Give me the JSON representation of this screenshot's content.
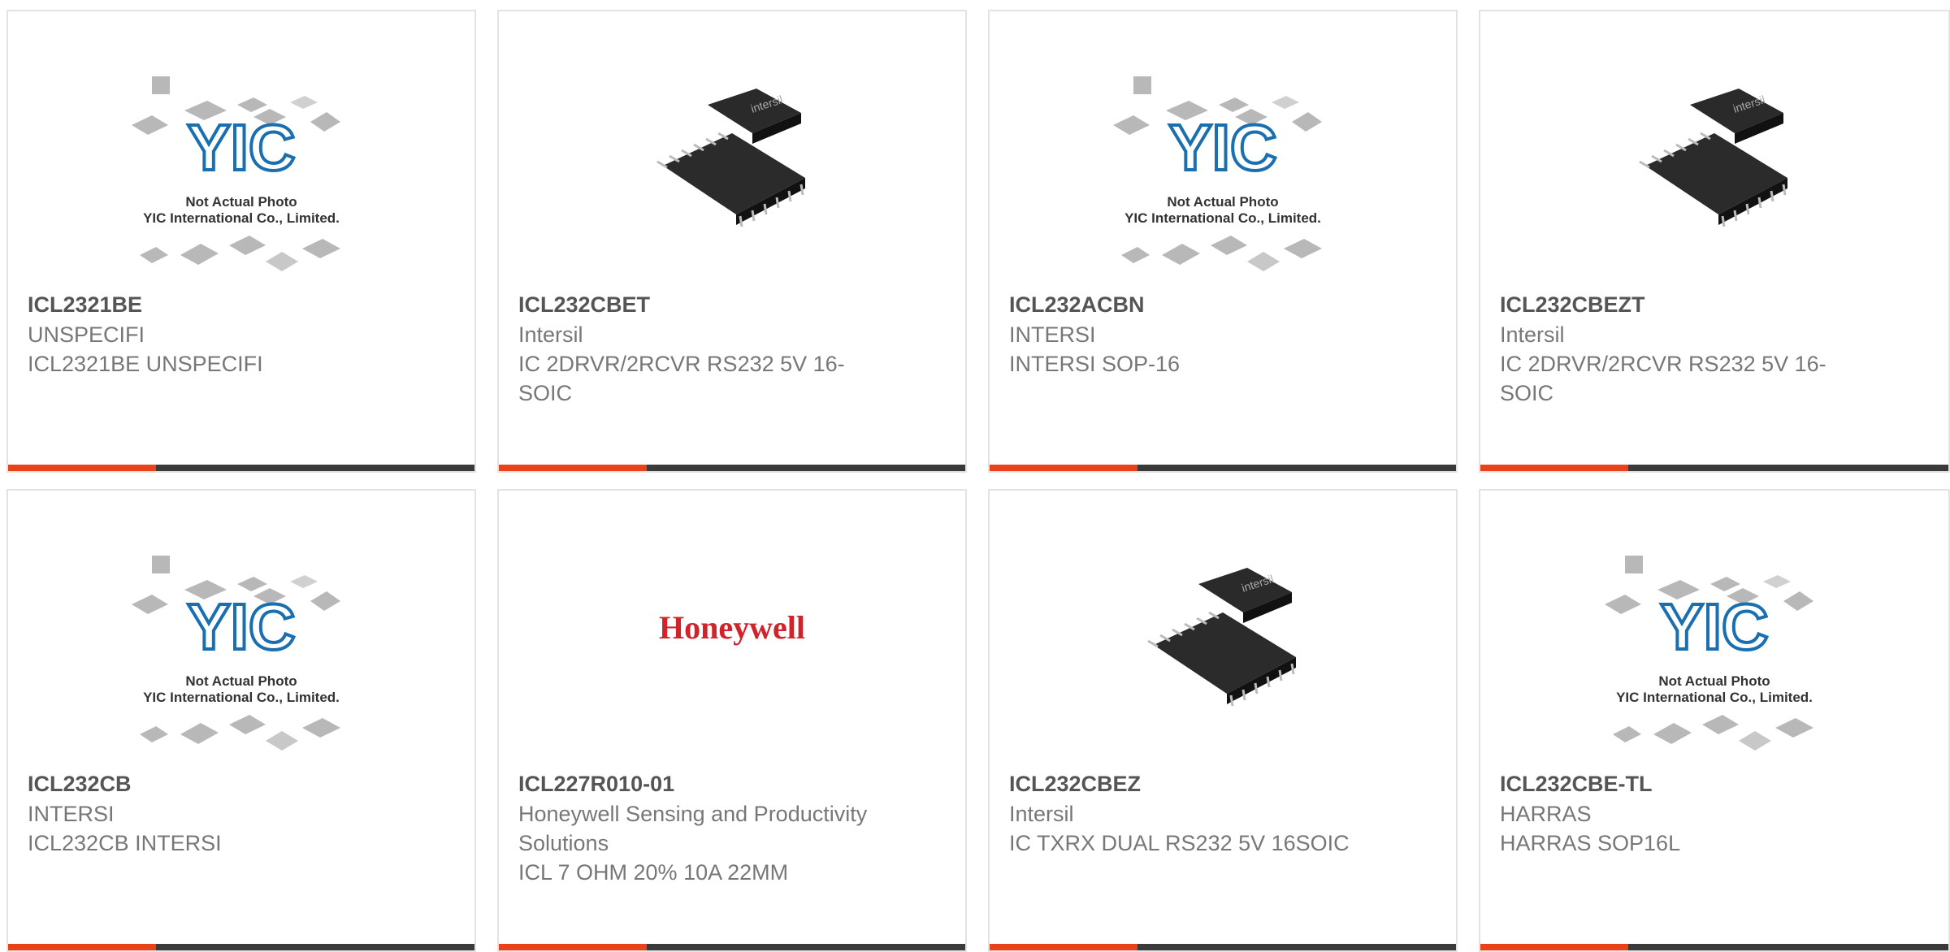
{
  "accent_color": "#e8421c",
  "bar_color": "#3a3a3a",
  "placeholder_image": {
    "line1": "Not Actual Photo",
    "line2": "YIC International Co., Limited.",
    "logo": "YIC"
  },
  "products": [
    {
      "part_number": "ICL2321BE",
      "manufacturer": "UNSPECIFI",
      "description": "ICL2321BE UNSPECIFI",
      "image": "yic-placeholder"
    },
    {
      "part_number": "ICL232CBET",
      "manufacturer": "Intersil",
      "description": "IC 2DRVR/2RCVR RS232 5V 16-SOIC",
      "image": "intersil-chip"
    },
    {
      "part_number": "ICL232ACBN",
      "manufacturer": "INTERSI",
      "description": "INTERSI SOP-16",
      "image": "yic-placeholder"
    },
    {
      "part_number": "ICL232CBEZT",
      "manufacturer": "Intersil",
      "description": "IC 2DRVR/2RCVR RS232 5V 16-SOIC",
      "image": "intersil-chip"
    },
    {
      "part_number": "ICL232CB",
      "manufacturer": "INTERSI",
      "description": "ICL232CB INTERSI",
      "image": "yic-placeholder"
    },
    {
      "part_number": "ICL227R010-01",
      "manufacturer": "Honeywell Sensing and Productivity Solutions",
      "description": "ICL 7 OHM 20% 10A 22MM",
      "image": "honeywell-logo",
      "logo_text": "Honeywell"
    },
    {
      "part_number": "ICL232CBEZ",
      "manufacturer": "Intersil",
      "description": "IC TXRX DUAL RS232 5V 16SOIC",
      "image": "intersil-chip"
    },
    {
      "part_number": "ICL232CBE-TL",
      "manufacturer": "HARRAS",
      "description": "HARRAS SOP16L",
      "image": "yic-placeholder"
    }
  ]
}
